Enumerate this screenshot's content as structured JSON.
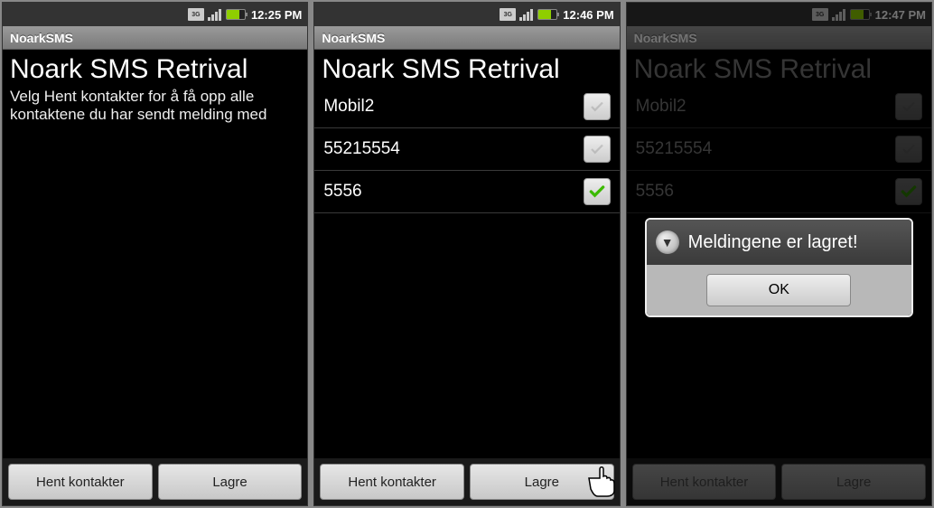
{
  "screens": [
    {
      "status": {
        "time": "12:25 PM",
        "network": "3G"
      },
      "title": "NoarkSMS",
      "heading": "Noark SMS Retrival",
      "subtext": "Velg Hent kontakter for å få opp alle kontaktene du har sendt melding med",
      "footer": {
        "left": "Hent kontakter",
        "right": "Lagre"
      }
    },
    {
      "status": {
        "time": "12:46 PM",
        "network": "3G"
      },
      "title": "NoarkSMS",
      "heading": "Noark SMS Retrival",
      "contacts": [
        {
          "label": "Mobil2",
          "checked": false
        },
        {
          "label": "55215554",
          "checked": false
        },
        {
          "label": "5556",
          "checked": true
        }
      ],
      "footer": {
        "left": "Hent kontakter",
        "right": "Lagre"
      }
    },
    {
      "status": {
        "time": "12:47 PM",
        "network": "3G"
      },
      "title": "NoarkSMS",
      "heading": "Noark SMS Retrival",
      "contacts": [
        {
          "label": "Mobil2",
          "checked": false
        },
        {
          "label": "55215554",
          "checked": false
        },
        {
          "label": "5556",
          "checked": true
        }
      ],
      "footer": {
        "left": "Hent kontakter",
        "right": "Lagre"
      },
      "dialog": {
        "title": "Meldingene er lagret!",
        "ok": "OK"
      }
    }
  ]
}
